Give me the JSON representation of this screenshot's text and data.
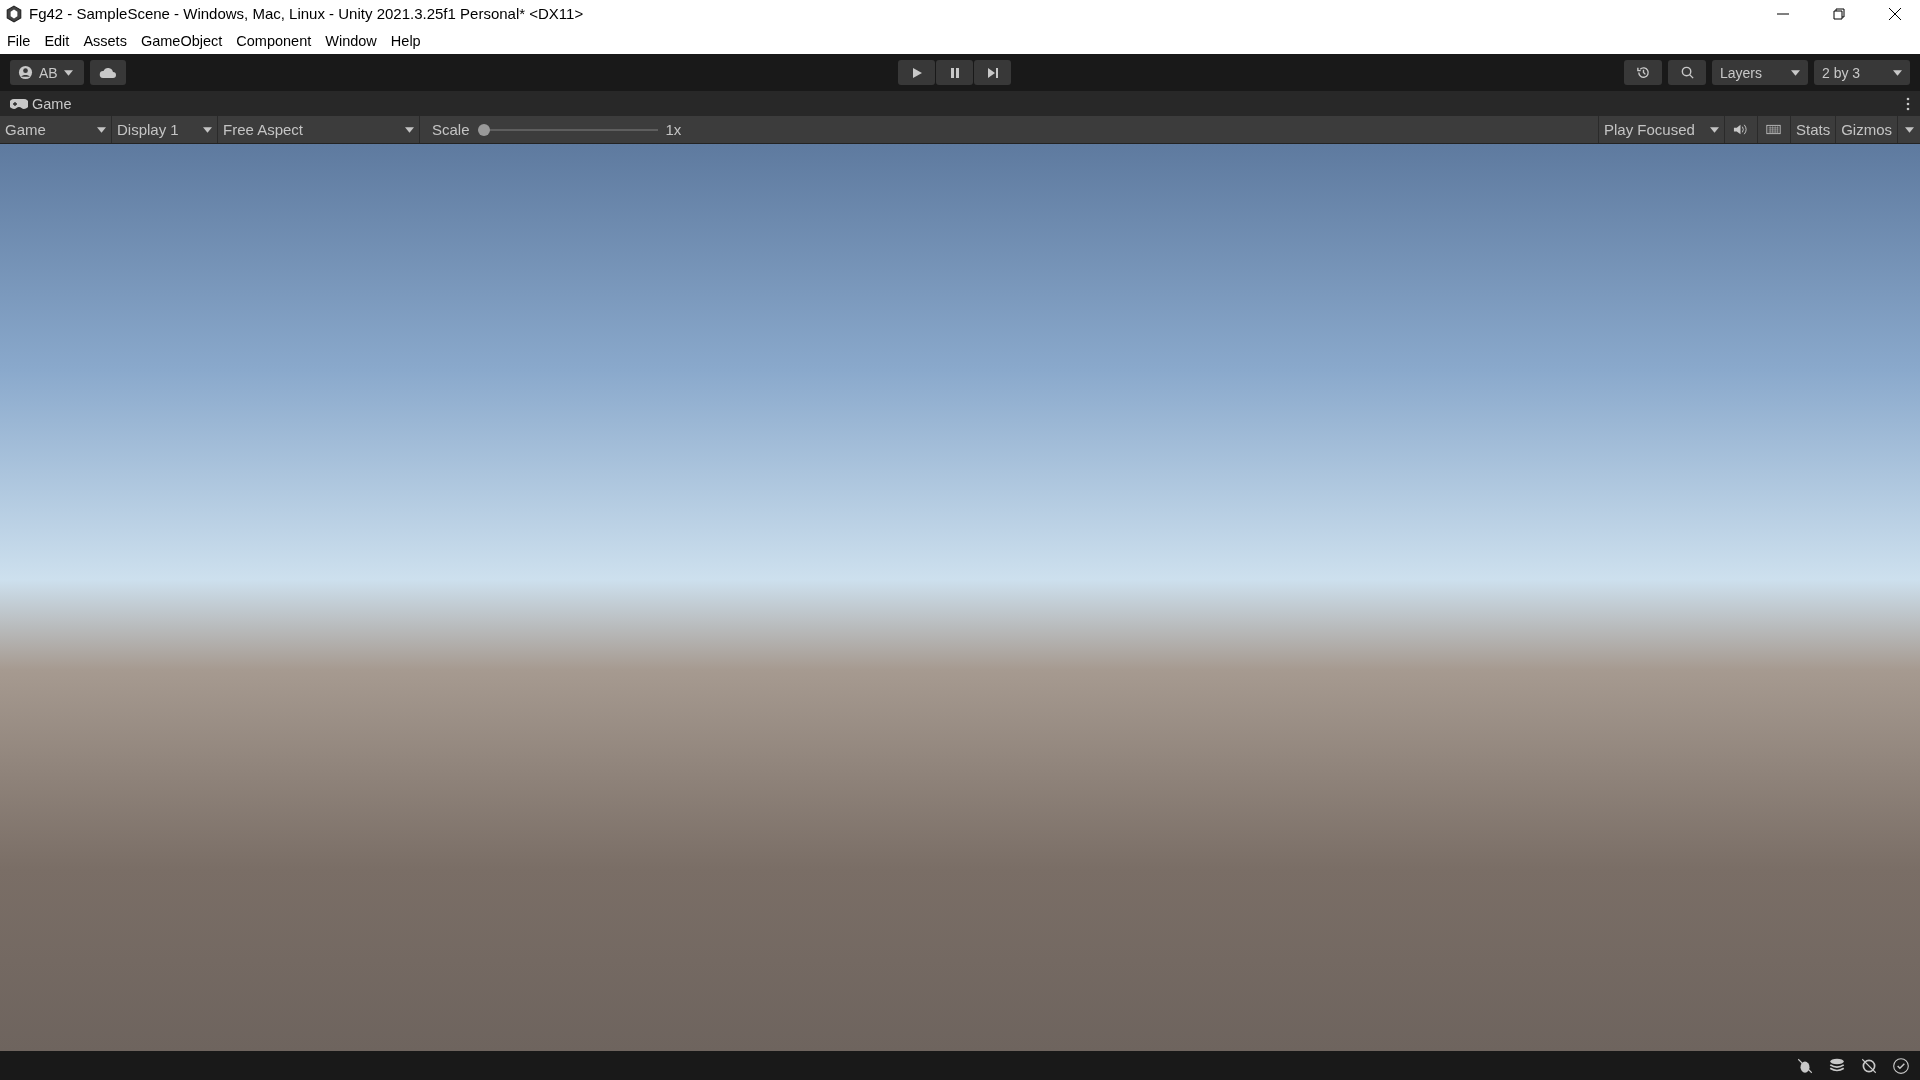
{
  "window": {
    "title": "Fg42 - SampleScene - Windows, Mac, Linux - Unity 2021.3.25f1 Personal* <DX11>"
  },
  "menu": [
    "File",
    "Edit",
    "Assets",
    "GameObject",
    "Component",
    "Window",
    "Help"
  ],
  "toolbar": {
    "account": "AB",
    "layers": "Layers",
    "layout": "2 by 3"
  },
  "panel_tab": {
    "label": "Game"
  },
  "game_toolbar": {
    "view": "Game",
    "display": "Display 1",
    "aspect": "Free Aspect",
    "scale": {
      "label": "Scale",
      "level": 0,
      "reading": "1x"
    },
    "play_mode": "Play Focused",
    "stats": "Stats",
    "gizmos": "Gizmos"
  }
}
